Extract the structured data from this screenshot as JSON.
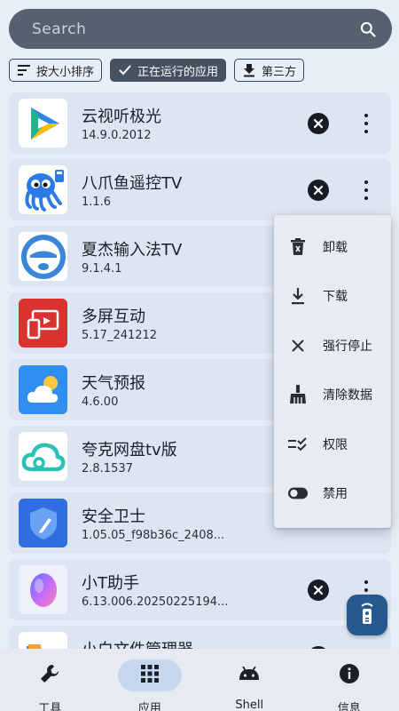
{
  "search": {
    "placeholder": "Search",
    "icon": "search-icon"
  },
  "filters": [
    {
      "label": "按大小排序",
      "icon": "sort-icon",
      "active": false
    },
    {
      "label": "正在运行的应用",
      "icon": "check-icon",
      "active": true
    },
    {
      "label": "第三方",
      "icon": "download-icon",
      "active": false
    }
  ],
  "apps": [
    {
      "name": "云视听极光",
      "version": "14.9.0.2012",
      "icon": "yunshiting-app-icon"
    },
    {
      "name": "八爪鱼遥控TV",
      "version": "1.1.6",
      "icon": "octopus-remote-app-icon"
    },
    {
      "name": "夏杰输入法TV",
      "version": "9.1.4.1",
      "icon": "xiajie-input-app-icon"
    },
    {
      "name": "多屏互动",
      "version": "5.17_241212",
      "icon": "multi-screen-app-icon"
    },
    {
      "name": "天气预报",
      "version": "4.6.00",
      "icon": "weather-app-icon"
    },
    {
      "name": "夸克网盘tv版",
      "version": "2.8.1537",
      "icon": "quark-cloud-app-icon"
    },
    {
      "name": "安全卫士",
      "version": "1.05.05_f98b36c_2408...",
      "icon": "security-app-icon"
    },
    {
      "name": "小T助手",
      "version": "6.13.006.20250225194...",
      "icon": "xiaot-assistant-app-icon"
    },
    {
      "name": "小白文件管理器",
      "version": "",
      "icon": "file-manager-app-icon"
    }
  ],
  "context_menu": [
    {
      "label": "卸载",
      "icon": "trash-icon"
    },
    {
      "label": "下载",
      "icon": "download-icon"
    },
    {
      "label": "强行停止",
      "icon": "close-icon"
    },
    {
      "label": "清除数据",
      "icon": "broom-icon"
    },
    {
      "label": "权限",
      "icon": "permissions-icon"
    },
    {
      "label": "禁用",
      "icon": "toggle-icon"
    }
  ],
  "fab": {
    "icon": "remote-control-icon"
  },
  "nav": [
    {
      "label": "工具",
      "icon": "wrench-icon",
      "active": false
    },
    {
      "label": "应用",
      "icon": "grid-icon",
      "active": true
    },
    {
      "label": "Shell",
      "icon": "android-icon",
      "active": false
    },
    {
      "label": "信息",
      "icon": "info-icon",
      "active": false
    }
  ],
  "colors": {
    "accent": "#475261",
    "background": "#e8eef7",
    "card": "#dde5f3",
    "fab": "#26598f"
  }
}
